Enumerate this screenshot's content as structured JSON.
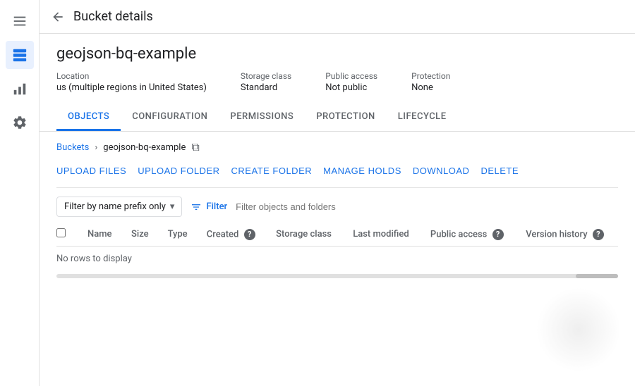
{
  "topbar": {
    "title": "Bucket details",
    "back_icon": "←"
  },
  "bucket": {
    "name": "geojson-bq-example",
    "meta": {
      "location_label": "Location",
      "location_value": "us (multiple regions in United States)",
      "storage_class_label": "Storage class",
      "storage_class_value": "Standard",
      "public_access_label": "Public access",
      "public_access_value": "Not public",
      "protection_label": "Protection",
      "protection_value": "None"
    }
  },
  "tabs": [
    {
      "id": "objects",
      "label": "OBJECTS",
      "active": true
    },
    {
      "id": "configuration",
      "label": "CONFIGURATION",
      "active": false
    },
    {
      "id": "permissions",
      "label": "PERMISSIONS",
      "active": false
    },
    {
      "id": "protection",
      "label": "PROTECTION",
      "active": false
    },
    {
      "id": "lifecycle",
      "label": "LIFECYCLE",
      "active": false
    }
  ],
  "breadcrumb": {
    "root": "Buckets",
    "separator": "›",
    "current": "geojson-bq-example",
    "copy_tooltip": "Copy path"
  },
  "actions": {
    "upload_files": "UPLOAD FILES",
    "upload_folder": "UPLOAD FOLDER",
    "create_folder": "CREATE FOLDER",
    "manage_holds": "MANAGE HOLDS",
    "download": "DOWNLOAD",
    "delete": "DELETE"
  },
  "filter": {
    "prefix_label": "Filter by name prefix only",
    "filter_label": "Filter",
    "input_placeholder": "Filter objects and folders"
  },
  "table": {
    "columns": [
      {
        "id": "checkbox",
        "label": ""
      },
      {
        "id": "name",
        "label": "Name"
      },
      {
        "id": "size",
        "label": "Size"
      },
      {
        "id": "type",
        "label": "Type"
      },
      {
        "id": "created",
        "label": "Created",
        "has_help": true
      },
      {
        "id": "storage_class",
        "label": "Storage class"
      },
      {
        "id": "last_modified",
        "label": "Last modified"
      },
      {
        "id": "public_access",
        "label": "Public access",
        "has_help": true
      },
      {
        "id": "version_history",
        "label": "Version history",
        "has_help": true
      }
    ],
    "no_rows_text": "No rows to display",
    "rows": []
  },
  "sidebar": {
    "icons": [
      {
        "id": "menu",
        "label": "Menu",
        "active": false
      },
      {
        "id": "storage",
        "label": "Storage",
        "active": true
      },
      {
        "id": "analytics",
        "label": "Analytics",
        "active": false
      },
      {
        "id": "settings",
        "label": "Settings",
        "active": false
      }
    ]
  }
}
